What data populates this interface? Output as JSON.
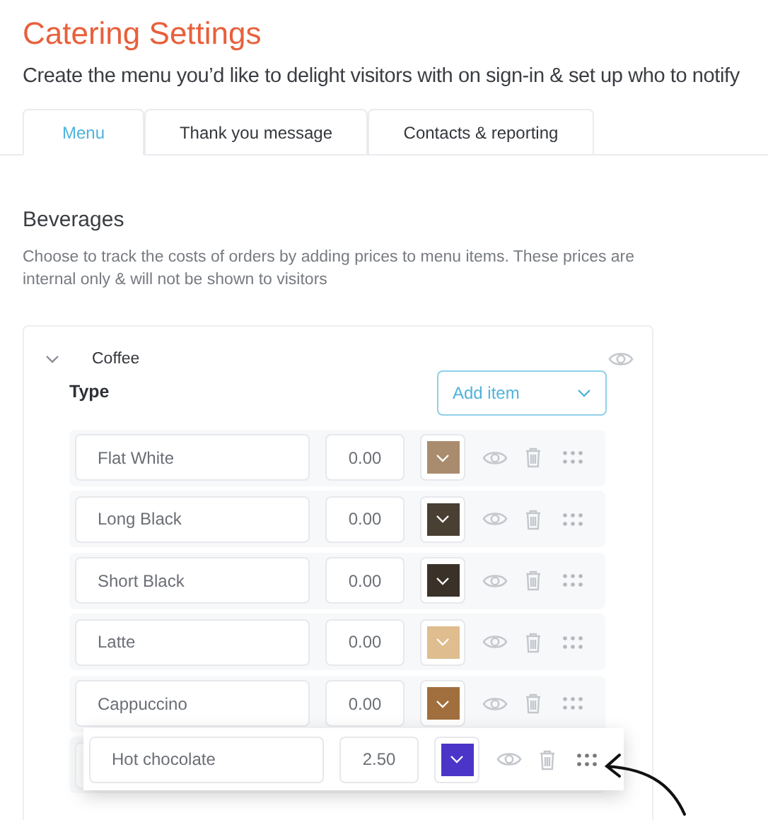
{
  "page": {
    "title": "Catering Settings",
    "subtitle": "Create the menu you’d like to delight visitors with on sign-in & set up who to notify"
  },
  "tabs": [
    {
      "label": "Menu",
      "selected": true
    },
    {
      "label": "Thank you message",
      "selected": false
    },
    {
      "label": "Contacts & reporting",
      "selected": false
    }
  ],
  "section": {
    "title": "Beverages",
    "description": "Choose to track the costs of orders by adding prices to menu items. These prices are internal only & will not be shown to visitors"
  },
  "category": {
    "name": "Coffee",
    "expanded": true,
    "type_label": "Type",
    "add_button": "Add item",
    "items": [
      {
        "kind": "row",
        "name": "Flat White",
        "price": "0.00",
        "color": "#a98c6e"
      },
      {
        "kind": "row",
        "name": "Long Black",
        "price": "0.00",
        "color": "#4a3f33"
      },
      {
        "kind": "row",
        "name": "Short Black",
        "price": "0.00",
        "color": "#3a3128"
      },
      {
        "kind": "row",
        "name": "Latte",
        "price": "0.00",
        "color": "#dfbd8f"
      },
      {
        "kind": "row",
        "name": "Cappuccino",
        "price": "0.00",
        "color": "#a06f3d"
      },
      {
        "kind": "dragging",
        "name": "Hot chocolate",
        "price": "2.50",
        "color": "#4b35c8"
      }
    ]
  }
}
